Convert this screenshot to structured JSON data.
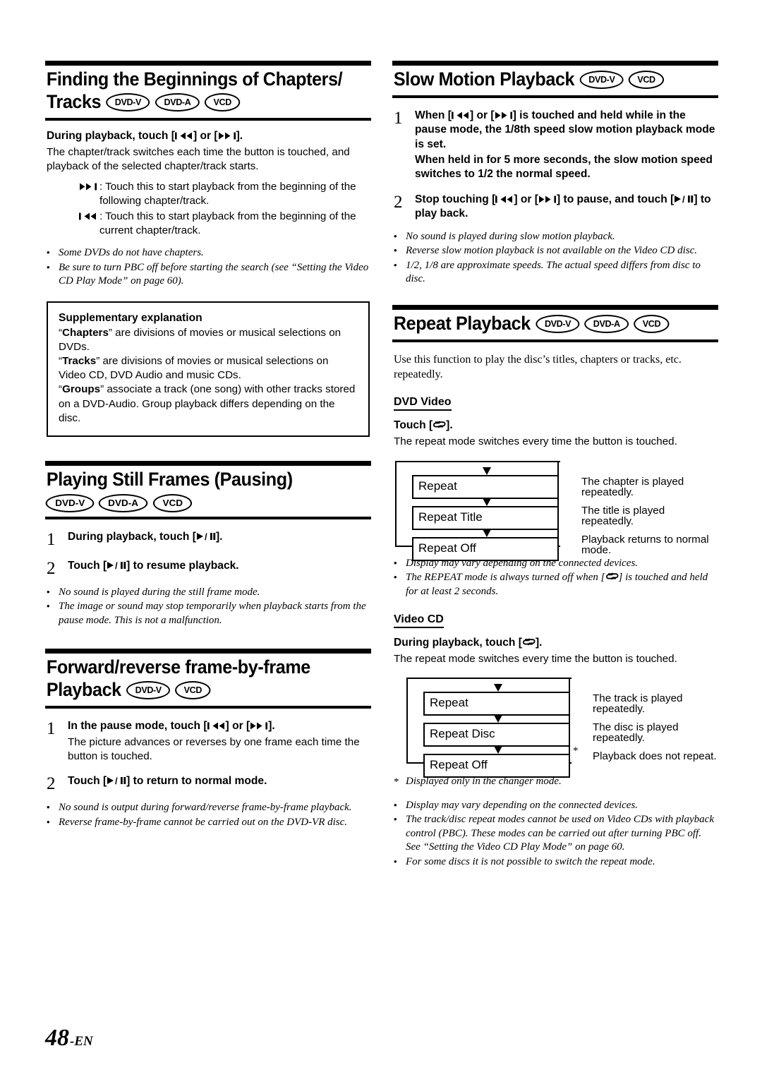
{
  "page": {
    "folio_number": "48",
    "folio_suffix": "-EN"
  },
  "badges": {
    "dvd_v": "DVD-V",
    "dvd_a": "DVD-A",
    "vcd": "VCD"
  },
  "left_column": {
    "section_finding": {
      "title": "Finding the Beginnings of Chapters/ Tracks",
      "title_line1": "Finding the Beginnings of Chapters/",
      "title_line2": "Tracks",
      "badges": [
        "DVD-V",
        "DVD-A",
        "VCD"
      ],
      "lead": "During playback, touch [",
      "lead_mid": "] or [",
      "lead_end": "].",
      "body": "The chapter/track switches each time the button is touched, and playback of the selected chapter/track starts.",
      "definitions": [
        {
          "symbol": "next-track-icon",
          "text": ": Touch this to start playback from the beginning of the following chapter/track."
        },
        {
          "symbol": "previous-track-icon",
          "text": ": Touch this to start playback from the beginning of the current chapter/track."
        }
      ],
      "notes": [
        "Some DVDs do not have chapters.",
        "Be sure to turn PBC off before starting the search (see “Setting the Video CD Play Mode” on page 60)."
      ],
      "supplementary": {
        "title": "Supplementary explanation",
        "para1_q": "Chapters",
        "para1_rest": "” are divisions of movies or musical selections on DVDs.",
        "para2_q": "Tracks",
        "para2_rest": "” are divisions of movies or musical selections on Video CD, DVD Audio and music CDs.",
        "para3_q": "Groups",
        "para3_rest": "” associate a track (one song) with other tracks stored on a DVD-Audio. Group playback differs depending on the disc."
      }
    },
    "section_still": {
      "title": "Playing Still Frames (Pausing)",
      "badges": [
        "DVD-V",
        "DVD-A",
        "VCD"
      ],
      "steps": [
        {
          "num": "1",
          "head_pre": "During playback, touch [",
          "head_post": "]."
        },
        {
          "num": "2",
          "head_pre": "Touch [",
          "head_post": "] to resume playback."
        }
      ],
      "notes": [
        "No sound is played during the still frame mode.",
        "The image or sound may stop temporarily when playback starts from the pause mode. This is not a malfunction."
      ]
    },
    "section_frame": {
      "title_line1": "Forward/reverse frame-by-frame",
      "title_line2": "Playback",
      "badges": [
        "DVD-V",
        "VCD"
      ],
      "steps": [
        {
          "num": "1",
          "head_pre": "In the pause mode, touch [",
          "head_mid": "] or [",
          "head_post": "].",
          "sub": "The picture advances or reverses by one frame each time the button is touched."
        },
        {
          "num": "2",
          "head_pre": "Touch [",
          "head_post": "] to return to normal mode."
        }
      ],
      "notes": [
        "No sound is output during forward/reverse frame-by-frame playback.",
        "Reverse frame-by-frame cannot be carried out on the DVD-VR disc."
      ]
    }
  },
  "right_column": {
    "section_slow": {
      "title": "Slow Motion Playback",
      "badges": [
        "DVD-V",
        "VCD"
      ],
      "steps": [
        {
          "num": "1",
          "head_pre": "When [",
          "head_mid": "] or [",
          "head_post": "] is touched and held while in the pause mode, the 1/8th speed slow motion playback mode is set.",
          "head_second": "When held in for 5 more seconds, the slow motion speed switches to 1/2 the normal speed."
        },
        {
          "num": "2",
          "head_pre": "Stop touching [",
          "head_mid": "] or [",
          "head_post": "] to pause, and touch [",
          "head_end": "] to play back."
        }
      ],
      "notes": [
        "No sound is played during slow motion playback.",
        "Reverse slow motion playback is not available on the Video CD disc.",
        "1/2, 1/8 are approximate speeds. The actual speed differs from disc to disc."
      ]
    },
    "section_repeat": {
      "title": "Repeat Playback",
      "badges": [
        "DVD-V",
        "DVD-A",
        "VCD"
      ],
      "intro": "Use this function to play the disc’s titles, chapters or tracks, etc. repeatedly.",
      "dvd_video": {
        "subhead": "DVD Video",
        "lead_pre": "Touch [",
        "lead_post": "].",
        "lead_body": "The repeat mode switches every time the button is touched.",
        "flow": [
          {
            "label": "Repeat",
            "desc": "The chapter is played repeatedly.",
            "star": false
          },
          {
            "label": "Repeat Title",
            "desc": "The title is played repeatedly.",
            "star": false
          },
          {
            "label": "Repeat Off",
            "desc": "Playback returns to normal mode.",
            "star": false
          }
        ],
        "notes": [
          "Display may vary depending on the connected devices.",
          "The REPEAT mode is always turned off when [ ↺ ] is touched and held for at least 2 seconds."
        ],
        "note2_pre": "The REPEAT mode is always turned off when [",
        "note2_post": "] is touched and held for at least 2 seconds."
      },
      "video_cd": {
        "subhead": "Video CD",
        "lead_pre": "During playback, touch [",
        "lead_post": "].",
        "lead_body": "The repeat mode switches every time the button is touched.",
        "flow": [
          {
            "label": "Repeat",
            "desc": "The track is played repeatedly.",
            "star": false
          },
          {
            "label": "Repeat Disc",
            "desc": "The disc is played repeatedly.",
            "star": false
          },
          {
            "label": "Repeat Off",
            "desc": "Playback does not repeat.",
            "star": true
          }
        ],
        "footnote_mark": "*",
        "footnote": "Displayed only in the changer mode.",
        "notes": [
          "Display may vary depending on the connected devices.",
          "The track/disc repeat modes cannot be used on Video CDs with playback control (PBC). These modes can be carried out after turning PBC off. See “Setting the Video CD Play Mode” on page 60.",
          "For some discs it is not possible to switch the repeat mode."
        ]
      }
    }
  }
}
